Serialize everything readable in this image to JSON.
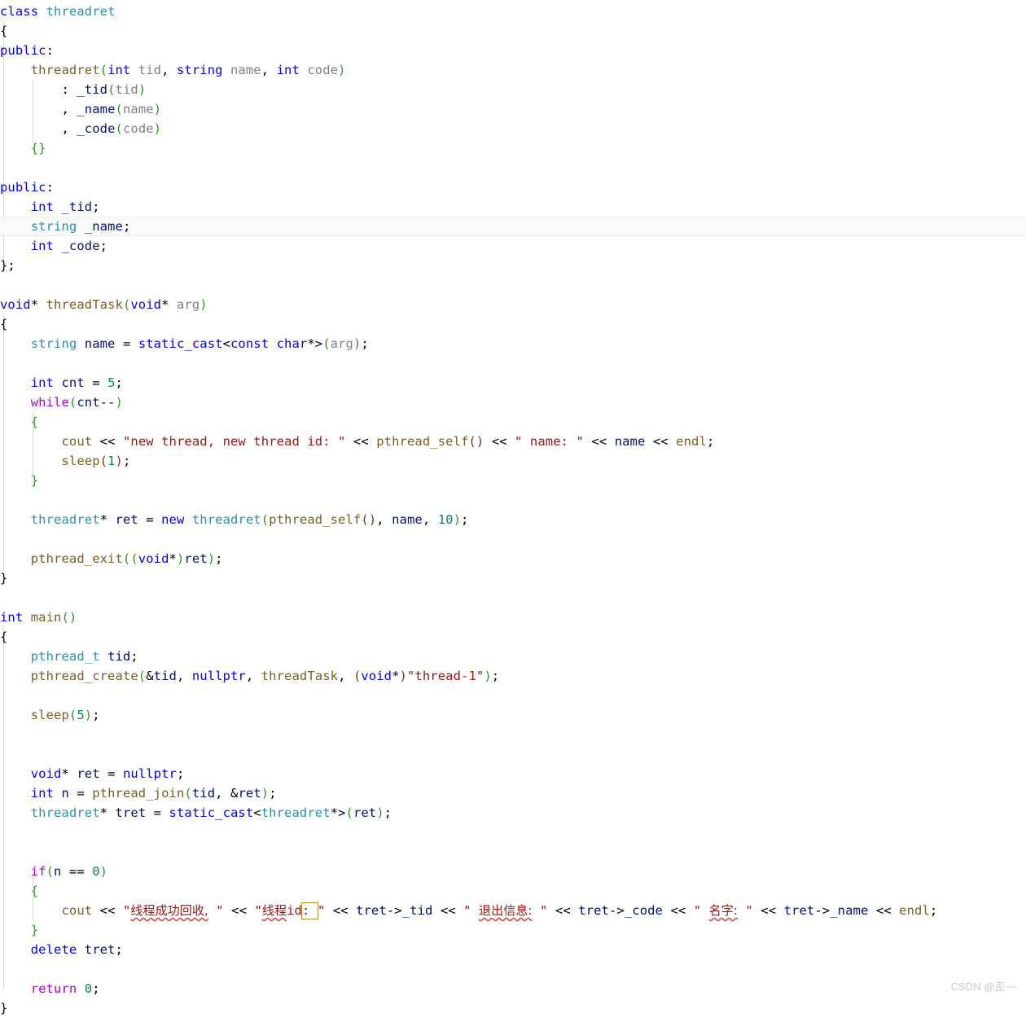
{
  "editor": {
    "language": "cpp",
    "background_color": "#ffffff",
    "current_line_index": 11,
    "theme_colors": {
      "keyword": "#0000ff",
      "control_keyword": "#af00db",
      "type": "#2b91af",
      "function": "#795e26",
      "variable": "#001080",
      "parameter": "#808080",
      "string": "#a31515",
      "number": "#098658",
      "punctuation": "#000000",
      "bracket_green": "#319331",
      "indent_guide": "#d4d4d4",
      "find_match_border": "#b58927",
      "spell_error_squiggle": "#d64040"
    },
    "lines": [
      "class threadret",
      "{",
      "public:",
      "    threadret(int tid, string name, int code)",
      "        : _tid(tid)",
      "        , _name(name)",
      "        , _code(code)",
      "    {}",
      "",
      "public:",
      "    int _tid;",
      "    string _name;",
      "    int _code;",
      "};",
      "",
      "void* threadTask(void* arg)",
      "{",
      "    string name = static_cast<const char*>(arg);",
      "",
      "    int cnt = 5;",
      "    while(cnt--)",
      "    {",
      "        cout << \"new thread, new thread id: \" << pthread_self() << \" name: \" << name << endl;",
      "        sleep(1);",
      "    }",
      "",
      "    threadret* ret = new threadret(pthread_self(), name, 10);",
      "",
      "    pthread_exit((void*)ret);",
      "}",
      "",
      "int main()",
      "{",
      "    pthread_t tid;",
      "    pthread_create(&tid, nullptr, threadTask, (void*)\"thread-1\");",
      "",
      "    sleep(5);",
      "",
      "",
      "    void* ret = nullptr;",
      "    int n = pthread_join(tid, &ret);",
      "    threadret* tret = static_cast<threadret*>(ret);",
      "",
      "",
      "    if(n == 0)",
      "    {",
      "        cout << \"线程成功回收, \" << \"线程id: \" << tret->_tid << \" 退出信息: \" << tret->_code << \" 名字: \" << tret->_name << endl;",
      "    }",
      "    delete tret;",
      "",
      "    return 0;",
      "}"
    ],
    "find_match": {
      "text": ": ",
      "line_index": 44,
      "description": "highlighted occurrence inside the \"线程id: \" string literal"
    },
    "tokens": {
      "keywords": [
        "class",
        "public",
        "int",
        "string",
        "void",
        "const",
        "char",
        "new",
        "delete",
        "static_cast",
        "nullptr"
      ],
      "control_keywords": [
        "while",
        "if",
        "return"
      ],
      "types": [
        "threadret",
        "pthread_t"
      ],
      "functions": [
        "threadTask",
        "cout",
        "endl",
        "pthread_self",
        "sleep",
        "pthread_exit",
        "main",
        "pthread_create",
        "pthread_join"
      ],
      "strings": [
        "\"new thread, new thread id: \"",
        "\" name: \"",
        "\"thread-1\"",
        "\"线程成功回收, \"",
        "\"线程id: \"",
        "\" 退出信息: \"",
        "\" 名字: \""
      ],
      "numbers": [
        "5",
        "1",
        "10",
        "0"
      ]
    }
  },
  "watermark": {
    "text": "CSDN @歪~~"
  }
}
